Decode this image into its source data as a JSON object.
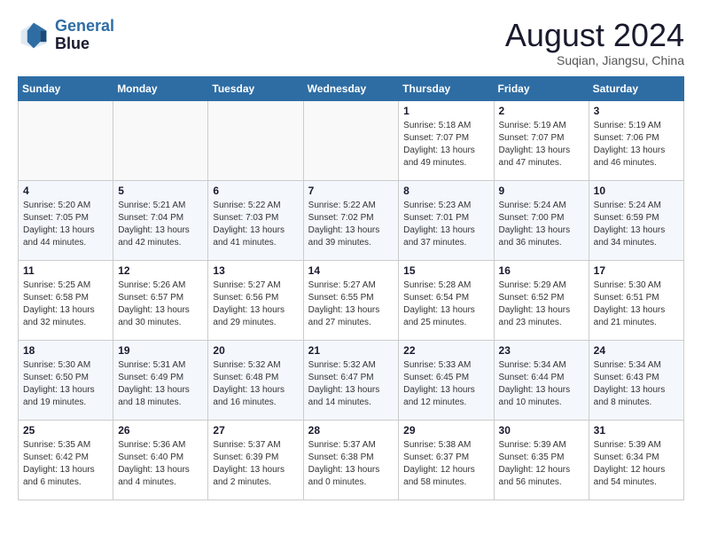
{
  "header": {
    "logo_line1": "General",
    "logo_line2": "Blue",
    "month_year": "August 2024",
    "location": "Suqian, Jiangsu, China"
  },
  "days_of_week": [
    "Sunday",
    "Monday",
    "Tuesday",
    "Wednesday",
    "Thursday",
    "Friday",
    "Saturday"
  ],
  "weeks": [
    [
      {
        "day": "",
        "info": ""
      },
      {
        "day": "",
        "info": ""
      },
      {
        "day": "",
        "info": ""
      },
      {
        "day": "",
        "info": ""
      },
      {
        "day": "1",
        "info": "Sunrise: 5:18 AM\nSunset: 7:07 PM\nDaylight: 13 hours\nand 49 minutes."
      },
      {
        "day": "2",
        "info": "Sunrise: 5:19 AM\nSunset: 7:07 PM\nDaylight: 13 hours\nand 47 minutes."
      },
      {
        "day": "3",
        "info": "Sunrise: 5:19 AM\nSunset: 7:06 PM\nDaylight: 13 hours\nand 46 minutes."
      }
    ],
    [
      {
        "day": "4",
        "info": "Sunrise: 5:20 AM\nSunset: 7:05 PM\nDaylight: 13 hours\nand 44 minutes."
      },
      {
        "day": "5",
        "info": "Sunrise: 5:21 AM\nSunset: 7:04 PM\nDaylight: 13 hours\nand 42 minutes."
      },
      {
        "day": "6",
        "info": "Sunrise: 5:22 AM\nSunset: 7:03 PM\nDaylight: 13 hours\nand 41 minutes."
      },
      {
        "day": "7",
        "info": "Sunrise: 5:22 AM\nSunset: 7:02 PM\nDaylight: 13 hours\nand 39 minutes."
      },
      {
        "day": "8",
        "info": "Sunrise: 5:23 AM\nSunset: 7:01 PM\nDaylight: 13 hours\nand 37 minutes."
      },
      {
        "day": "9",
        "info": "Sunrise: 5:24 AM\nSunset: 7:00 PM\nDaylight: 13 hours\nand 36 minutes."
      },
      {
        "day": "10",
        "info": "Sunrise: 5:24 AM\nSunset: 6:59 PM\nDaylight: 13 hours\nand 34 minutes."
      }
    ],
    [
      {
        "day": "11",
        "info": "Sunrise: 5:25 AM\nSunset: 6:58 PM\nDaylight: 13 hours\nand 32 minutes."
      },
      {
        "day": "12",
        "info": "Sunrise: 5:26 AM\nSunset: 6:57 PM\nDaylight: 13 hours\nand 30 minutes."
      },
      {
        "day": "13",
        "info": "Sunrise: 5:27 AM\nSunset: 6:56 PM\nDaylight: 13 hours\nand 29 minutes."
      },
      {
        "day": "14",
        "info": "Sunrise: 5:27 AM\nSunset: 6:55 PM\nDaylight: 13 hours\nand 27 minutes."
      },
      {
        "day": "15",
        "info": "Sunrise: 5:28 AM\nSunset: 6:54 PM\nDaylight: 13 hours\nand 25 minutes."
      },
      {
        "day": "16",
        "info": "Sunrise: 5:29 AM\nSunset: 6:52 PM\nDaylight: 13 hours\nand 23 minutes."
      },
      {
        "day": "17",
        "info": "Sunrise: 5:30 AM\nSunset: 6:51 PM\nDaylight: 13 hours\nand 21 minutes."
      }
    ],
    [
      {
        "day": "18",
        "info": "Sunrise: 5:30 AM\nSunset: 6:50 PM\nDaylight: 13 hours\nand 19 minutes."
      },
      {
        "day": "19",
        "info": "Sunrise: 5:31 AM\nSunset: 6:49 PM\nDaylight: 13 hours\nand 18 minutes."
      },
      {
        "day": "20",
        "info": "Sunrise: 5:32 AM\nSunset: 6:48 PM\nDaylight: 13 hours\nand 16 minutes."
      },
      {
        "day": "21",
        "info": "Sunrise: 5:32 AM\nSunset: 6:47 PM\nDaylight: 13 hours\nand 14 minutes."
      },
      {
        "day": "22",
        "info": "Sunrise: 5:33 AM\nSunset: 6:45 PM\nDaylight: 13 hours\nand 12 minutes."
      },
      {
        "day": "23",
        "info": "Sunrise: 5:34 AM\nSunset: 6:44 PM\nDaylight: 13 hours\nand 10 minutes."
      },
      {
        "day": "24",
        "info": "Sunrise: 5:34 AM\nSunset: 6:43 PM\nDaylight: 13 hours\nand 8 minutes."
      }
    ],
    [
      {
        "day": "25",
        "info": "Sunrise: 5:35 AM\nSunset: 6:42 PM\nDaylight: 13 hours\nand 6 minutes."
      },
      {
        "day": "26",
        "info": "Sunrise: 5:36 AM\nSunset: 6:40 PM\nDaylight: 13 hours\nand 4 minutes."
      },
      {
        "day": "27",
        "info": "Sunrise: 5:37 AM\nSunset: 6:39 PM\nDaylight: 13 hours\nand 2 minutes."
      },
      {
        "day": "28",
        "info": "Sunrise: 5:37 AM\nSunset: 6:38 PM\nDaylight: 13 hours\nand 0 minutes."
      },
      {
        "day": "29",
        "info": "Sunrise: 5:38 AM\nSunset: 6:37 PM\nDaylight: 12 hours\nand 58 minutes."
      },
      {
        "day": "30",
        "info": "Sunrise: 5:39 AM\nSunset: 6:35 PM\nDaylight: 12 hours\nand 56 minutes."
      },
      {
        "day": "31",
        "info": "Sunrise: 5:39 AM\nSunset: 6:34 PM\nDaylight: 12 hours\nand 54 minutes."
      }
    ]
  ]
}
